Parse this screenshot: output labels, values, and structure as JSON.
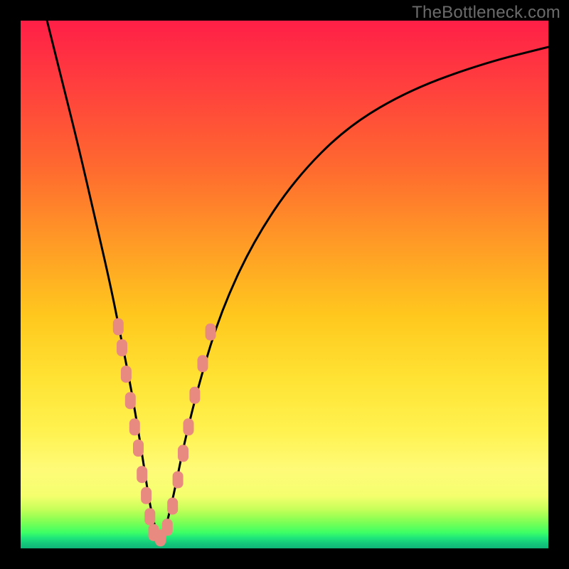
{
  "watermark": "TheBottleneck.com",
  "colors": {
    "frame": "#000000",
    "curve": "#000000",
    "marker_fill": "#e88a80",
    "marker_stroke": "#e88a80"
  },
  "chart_data": {
    "type": "line",
    "title": "",
    "xlabel": "",
    "ylabel": "",
    "xlim": [
      0,
      100
    ],
    "ylim": [
      0,
      100
    ],
    "grid": false,
    "legend": false,
    "note": "Axes are unlabeled in the source image; x and y are normalized 0–100 estimates read from pixel positions. The curve is a V-shaped bottleneck curve with minimum near x≈25.",
    "series": [
      {
        "name": "bottleneck-curve",
        "x": [
          5,
          8,
          11,
          14,
          17,
          19,
          21,
          23,
          24.5,
          26,
          27,
          29,
          31,
          34,
          38,
          44,
          52,
          62,
          74,
          88,
          100
        ],
        "y": [
          100,
          88,
          76,
          63,
          50,
          40,
          30,
          18,
          8,
          2,
          2,
          10,
          20,
          32,
          45,
          58,
          70,
          80,
          87,
          92,
          95
        ]
      }
    ],
    "markers": {
      "name": "highlighted-points",
      "note": "Pink rounded markers clustered near the valley on both arms of the V.",
      "points": [
        {
          "x": 18.5,
          "y": 42
        },
        {
          "x": 19.2,
          "y": 38
        },
        {
          "x": 20.0,
          "y": 33
        },
        {
          "x": 20.8,
          "y": 28
        },
        {
          "x": 21.6,
          "y": 23
        },
        {
          "x": 22.3,
          "y": 19
        },
        {
          "x": 23.0,
          "y": 14
        },
        {
          "x": 23.8,
          "y": 10
        },
        {
          "x": 24.5,
          "y": 6
        },
        {
          "x": 25.2,
          "y": 3
        },
        {
          "x": 26.5,
          "y": 2
        },
        {
          "x": 27.8,
          "y": 4
        },
        {
          "x": 28.8,
          "y": 8
        },
        {
          "x": 29.8,
          "y": 13
        },
        {
          "x": 30.8,
          "y": 18
        },
        {
          "x": 31.8,
          "y": 23
        },
        {
          "x": 33.0,
          "y": 29
        },
        {
          "x": 34.5,
          "y": 35
        },
        {
          "x": 36.0,
          "y": 41
        }
      ]
    }
  }
}
